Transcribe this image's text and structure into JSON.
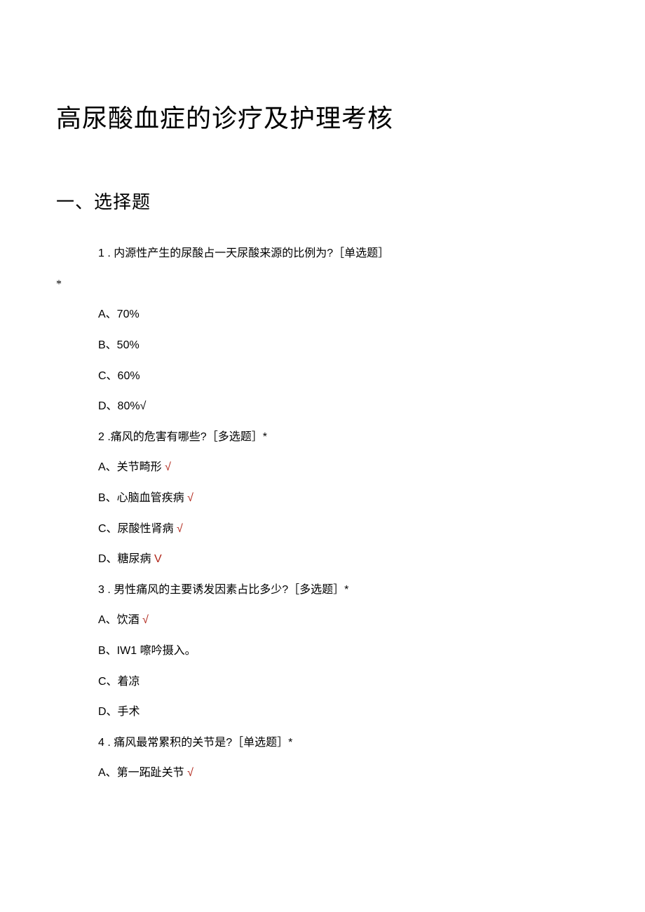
{
  "title": "高尿酸血症的诊疗及护理考核",
  "section_heading": "一、选择题",
  "q1": {
    "text": "1 . 内源性产生的尿酸占一天尿酸来源的比例为?［单选题］",
    "asterisk": "*",
    "a": "A、70%",
    "b": "B、50%",
    "c": "C、60%",
    "d": "D、80%√"
  },
  "q2": {
    "text": "2  .痛风的危害有哪些?［多选题］*",
    "a_text": "A、关节畸形",
    "a_check": " √",
    "b_text": "B、心脑血管疾病",
    "b_check": " √",
    "c_text": "C、尿酸性肾病",
    "c_check": " √",
    "d_text": "D、糖尿病",
    "d_check": " V"
  },
  "q3": {
    "text": "3  . 男性痛风的主要诱发因素占比多少?［多选题］*",
    "a_text": "A、饮酒",
    "a_check": " √",
    "b": "B、IW1 嚓吟摄入。",
    "c": "C、着凉",
    "d": "D、手术"
  },
  "q4": {
    "text": "4  . 痛风最常累积的关节是?［单选题］*",
    "a_text": "A、第一跖趾关节",
    "a_check": " √"
  }
}
